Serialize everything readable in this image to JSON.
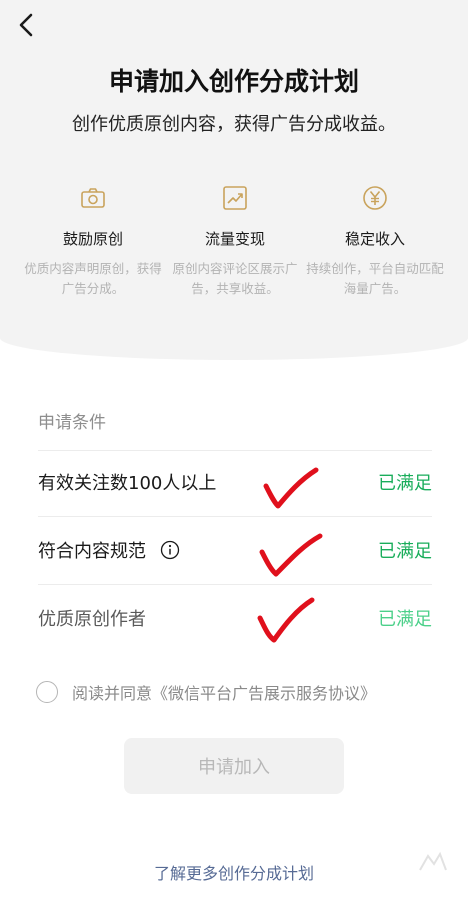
{
  "header": {
    "back_icon": "chevron-left-icon",
    "title": "申请加入创作分成计划",
    "subtitle": "创作优质原创内容，获得广告分成收益。"
  },
  "features": [
    {
      "icon": "camera-icon",
      "title": "鼓励原创",
      "desc": "优质内容声明原创，获得广告分成。"
    },
    {
      "icon": "trend-chart-icon",
      "title": "流量变现",
      "desc": "原创内容评论区展示广告，共享收益。"
    },
    {
      "icon": "yen-icon",
      "title": "稳定收入",
      "desc": "持续创作，平台自动匹配海量广告。"
    }
  ],
  "conditions": {
    "header": "申请条件",
    "items": [
      {
        "label": "有效关注数100人以上",
        "status": "已满足",
        "info": false
      },
      {
        "label": "符合内容规范",
        "status": "已满足",
        "info": true
      },
      {
        "label": "优质原创作者",
        "status": "已满足",
        "info": false
      }
    ]
  },
  "agreement": {
    "checked": false,
    "text": "阅读并同意《微信平台广告展示服务协议》"
  },
  "apply_button": {
    "label": "申请加入",
    "enabled": false
  },
  "learn_more": "了解更多创作分成计划",
  "colors": {
    "accent_gold": "#c9a35c",
    "status_green": "#1aad5b",
    "link_blue": "#576b95",
    "check_red": "#e0101c"
  }
}
